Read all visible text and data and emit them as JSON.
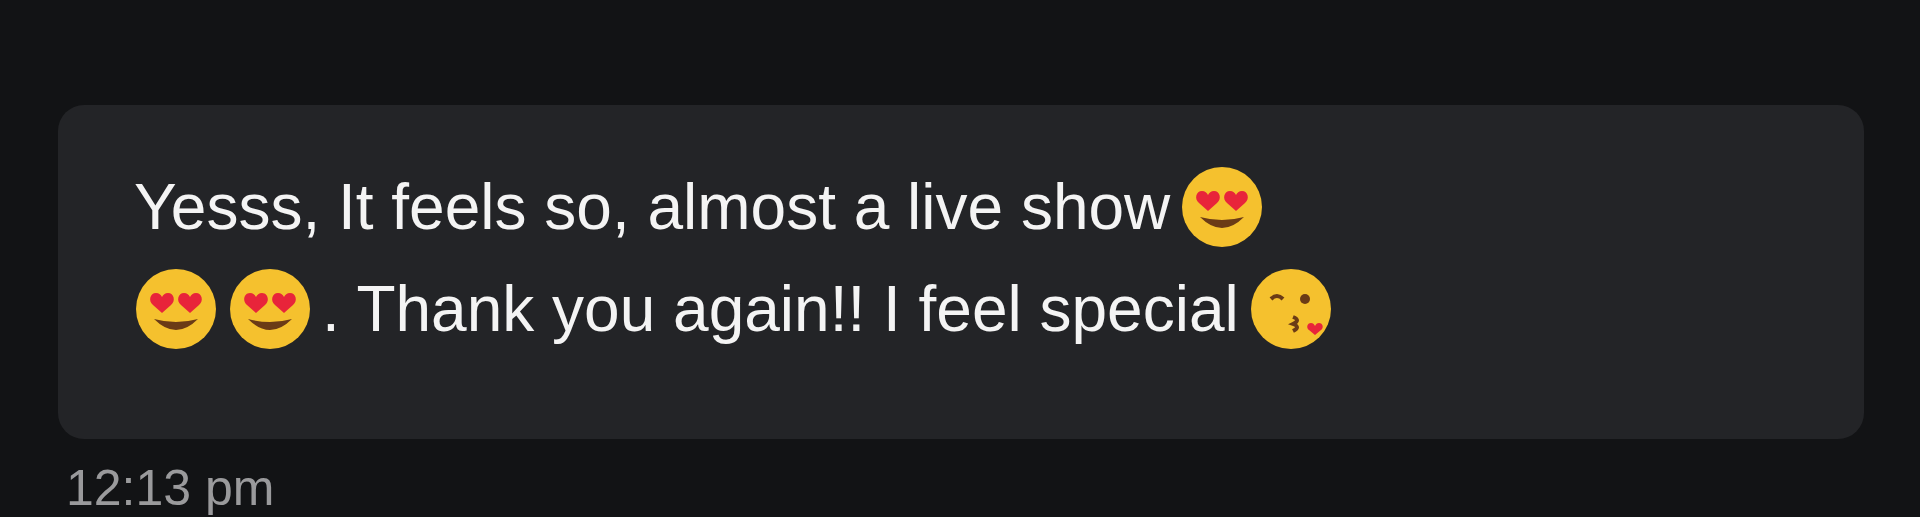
{
  "message": {
    "lines": [
      [
        {
          "kind": "text",
          "text": "Yesss, It feels so, almost a live show"
        },
        {
          "kind": "heart_eyes"
        }
      ],
      [
        {
          "kind": "heart_eyes"
        },
        {
          "kind": "heart_eyes"
        },
        {
          "kind": "text",
          "text": ". Thank you again!! I feel special"
        },
        {
          "kind": "kissing"
        }
      ]
    ],
    "time": "12:13 pm"
  }
}
